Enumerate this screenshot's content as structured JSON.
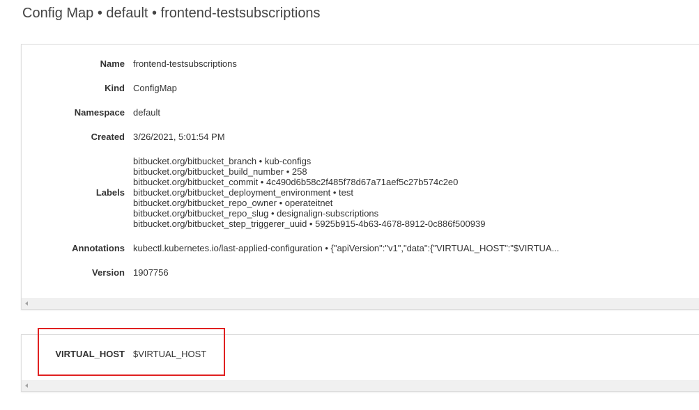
{
  "page": {
    "title": "Config Map • default • frontend-testsubscriptions"
  },
  "metadata": {
    "name_label": "Name",
    "name_value": "frontend-testsubscriptions",
    "kind_label": "Kind",
    "kind_value": "ConfigMap",
    "namespace_label": "Namespace",
    "namespace_value": "default",
    "created_label": "Created",
    "created_value": "3/26/2021, 5:01:54 PM",
    "labels_label": "Labels",
    "labels": [
      "bitbucket.org/bitbucket_branch • kub-configs",
      "bitbucket.org/bitbucket_build_number • 258",
      "bitbucket.org/bitbucket_commit • 4c490d6b58c2f485f78d67a71aef5c27b574c2e0",
      "bitbucket.org/bitbucket_deployment_environment • test",
      "bitbucket.org/bitbucket_repo_owner • operateitnet",
      "bitbucket.org/bitbucket_repo_slug • designalign-subscriptions",
      "bitbucket.org/bitbucket_step_triggerer_uuid • 5925b915-4b63-4678-8912-0c886f500939"
    ],
    "annotations_label": "Annotations",
    "annotations_value": "kubectl.kubernetes.io/last-applied-configuration • {\"apiVersion\":\"v1\",\"data\":{\"VIRTUAL_HOST\":\"$VIRTUA...",
    "version_label": "Version",
    "version_value": "1907756"
  },
  "data": {
    "key": "VIRTUAL_HOST",
    "value": "$VIRTUAL_HOST"
  },
  "colors": {
    "link": "#6a35a8",
    "highlight": "#e02020",
    "scrollbar": "#f0f0f0"
  }
}
